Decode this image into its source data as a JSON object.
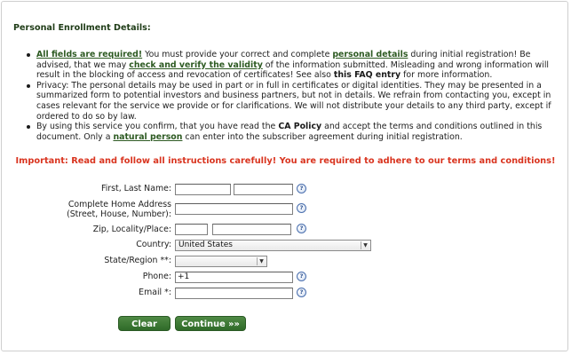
{
  "section_title": "Personal Enrollment Details:",
  "notes": {
    "item1": {
      "link1": "All fields are required!",
      "t1": " You must provide your correct and complete ",
      "link2": "personal details",
      "t2": " during initial registration! Be advised, that we may ",
      "link3": "check and verify the validity",
      "t3": " of the information submitted. Misleading and wrong information will result in the blocking of access and revocation of certificates! See also ",
      "link4": "this FAQ entry",
      "t4": " for more information."
    },
    "item2": {
      "t1": "Privacy: The personal details may be used in part or in full in certificates or digital identities. They may be presented in a summarized form to potential investors and business partners, but not in details. We refrain from contacting you, except in cases relevant for the service we provide or for clarifications. We will not distribute your details to any third party, except if ordered to do so by law."
    },
    "item3": {
      "t1": "By using this service you confirm, that you have read the ",
      "b1": "CA Policy",
      "t2": " and accept the terms and conditions outlined in this document. Only a ",
      "link1": "natural person",
      "t3": " can enter into the subscriber agreement during initial registration."
    }
  },
  "important": "Important: Read and follow all instructions carefully! You are required to adhere to our terms and conditions!",
  "form": {
    "name_label": "First, Last Name:",
    "address_label_1": "Complete Home Address",
    "address_label_2": "(Street, House, Number):",
    "zip_label": "Zip, Locality/Place:",
    "country_label": "Country:",
    "country_value": "United States",
    "state_label": "State/Region **:",
    "state_value": "",
    "phone_label": "Phone:",
    "phone_value": "+1",
    "email_label": "Email *:",
    "help_glyph": "?"
  },
  "buttons": {
    "clear": "Clear",
    "continue": "Continue »»"
  }
}
